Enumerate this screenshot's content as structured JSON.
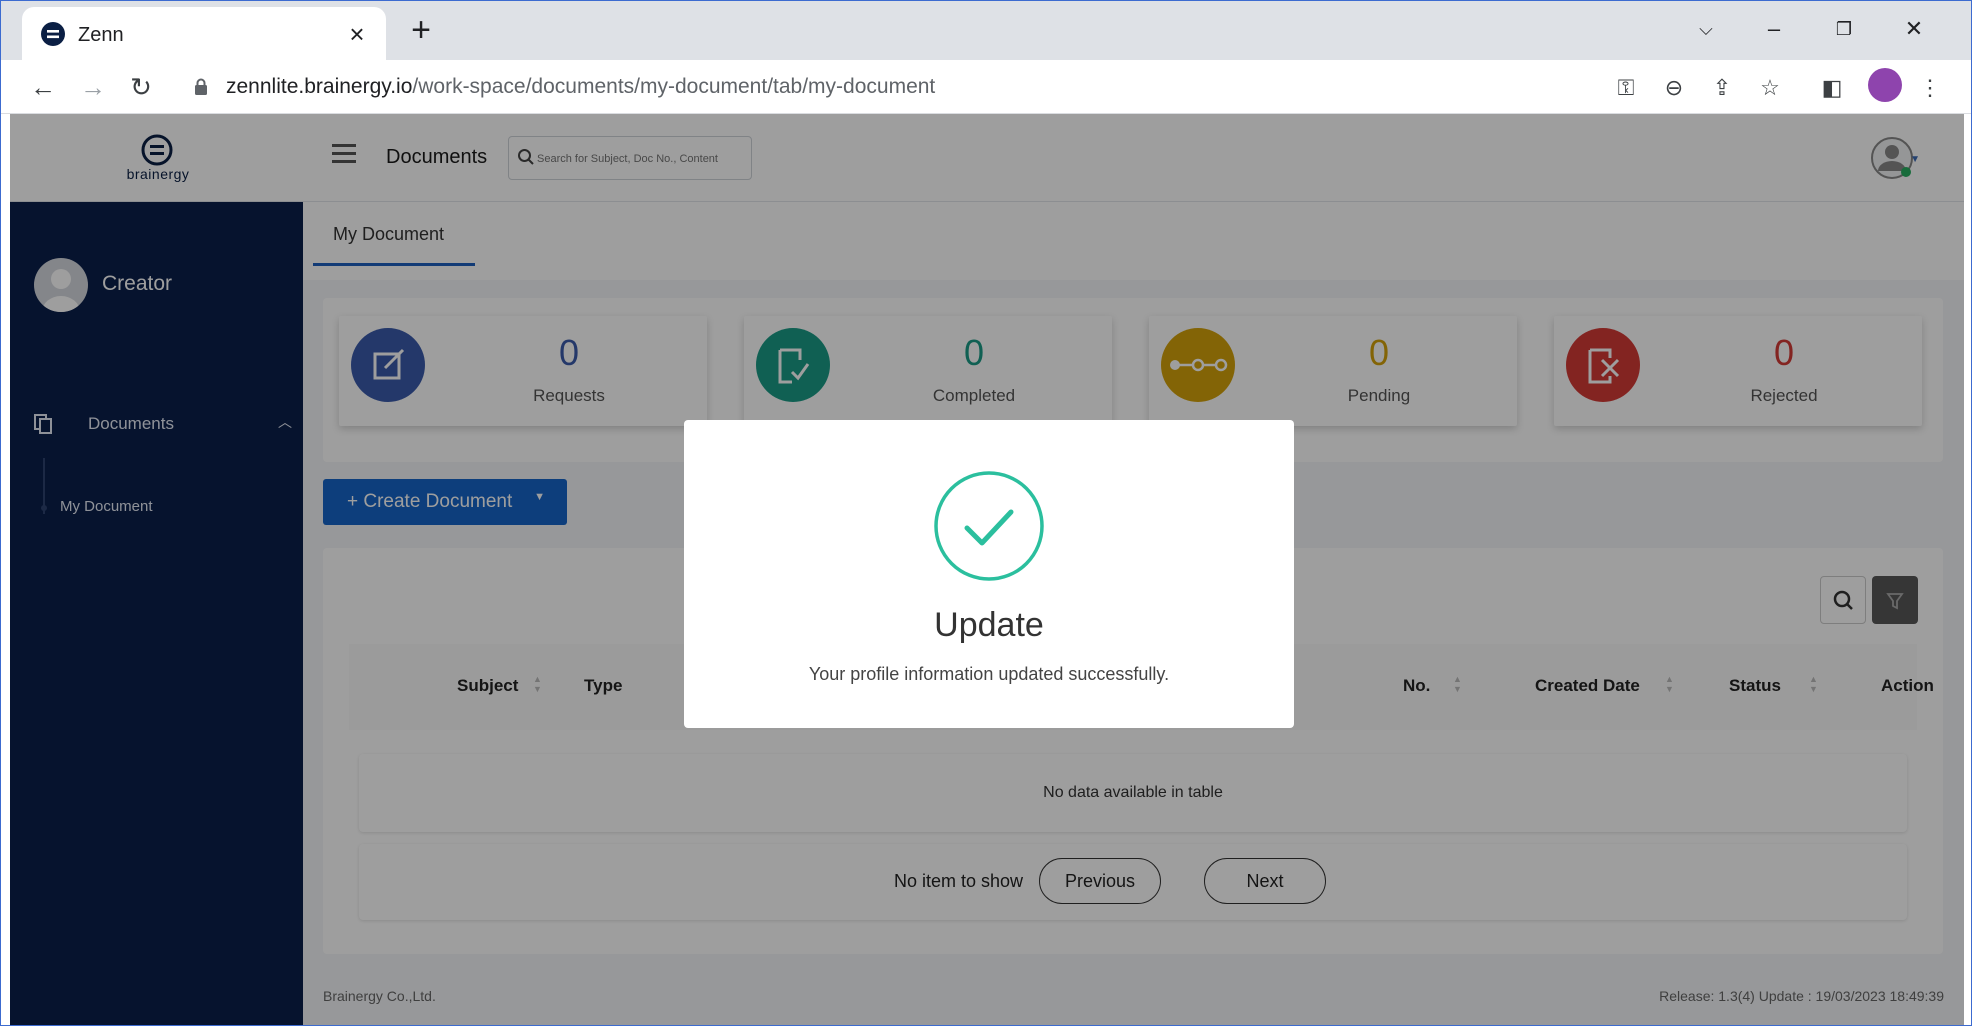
{
  "browser": {
    "tab_title": "Zenn",
    "url_host": "zennlite.brainergy.io",
    "url_path": "/work-space/documents/my-document/tab/my-document"
  },
  "header": {
    "logo_text": "brainergy",
    "title": "Documents",
    "search_placeholder": "Search for Subject, Doc No., Content"
  },
  "sidebar": {
    "user_name": "Creator",
    "group_label": "Documents",
    "items": [
      {
        "label": "My Document"
      }
    ]
  },
  "tabs": [
    {
      "label": "My Document",
      "active": true
    }
  ],
  "stats": [
    {
      "value": "0",
      "label": "Requests",
      "color": "#3b5bab",
      "icon": "edit-icon"
    },
    {
      "value": "0",
      "label": "Completed",
      "color": "#1a9b86",
      "icon": "check-doc-icon"
    },
    {
      "value": "0",
      "label": "Pending",
      "color": "#d4a20a",
      "icon": "flow-icon"
    },
    {
      "value": "0",
      "label": "Rejected",
      "color": "#d43a36",
      "icon": "reject-doc-icon"
    }
  ],
  "create_button": "+ Create Document",
  "table": {
    "columns": [
      "Subject",
      "Type",
      "No.",
      "Created Date",
      "Status",
      "Action"
    ],
    "empty_message": "No data available in table",
    "pager": {
      "info": "No item to show",
      "previous": "Previous",
      "next": "Next"
    }
  },
  "footer": {
    "company": "Brainergy Co.,Ltd.",
    "release": "Release: 1.3(4) Update : 19/03/2023 18:49:39"
  },
  "modal": {
    "title": "Update",
    "message": "Your profile information updated successfully.",
    "accent": "#2bbf9e"
  }
}
